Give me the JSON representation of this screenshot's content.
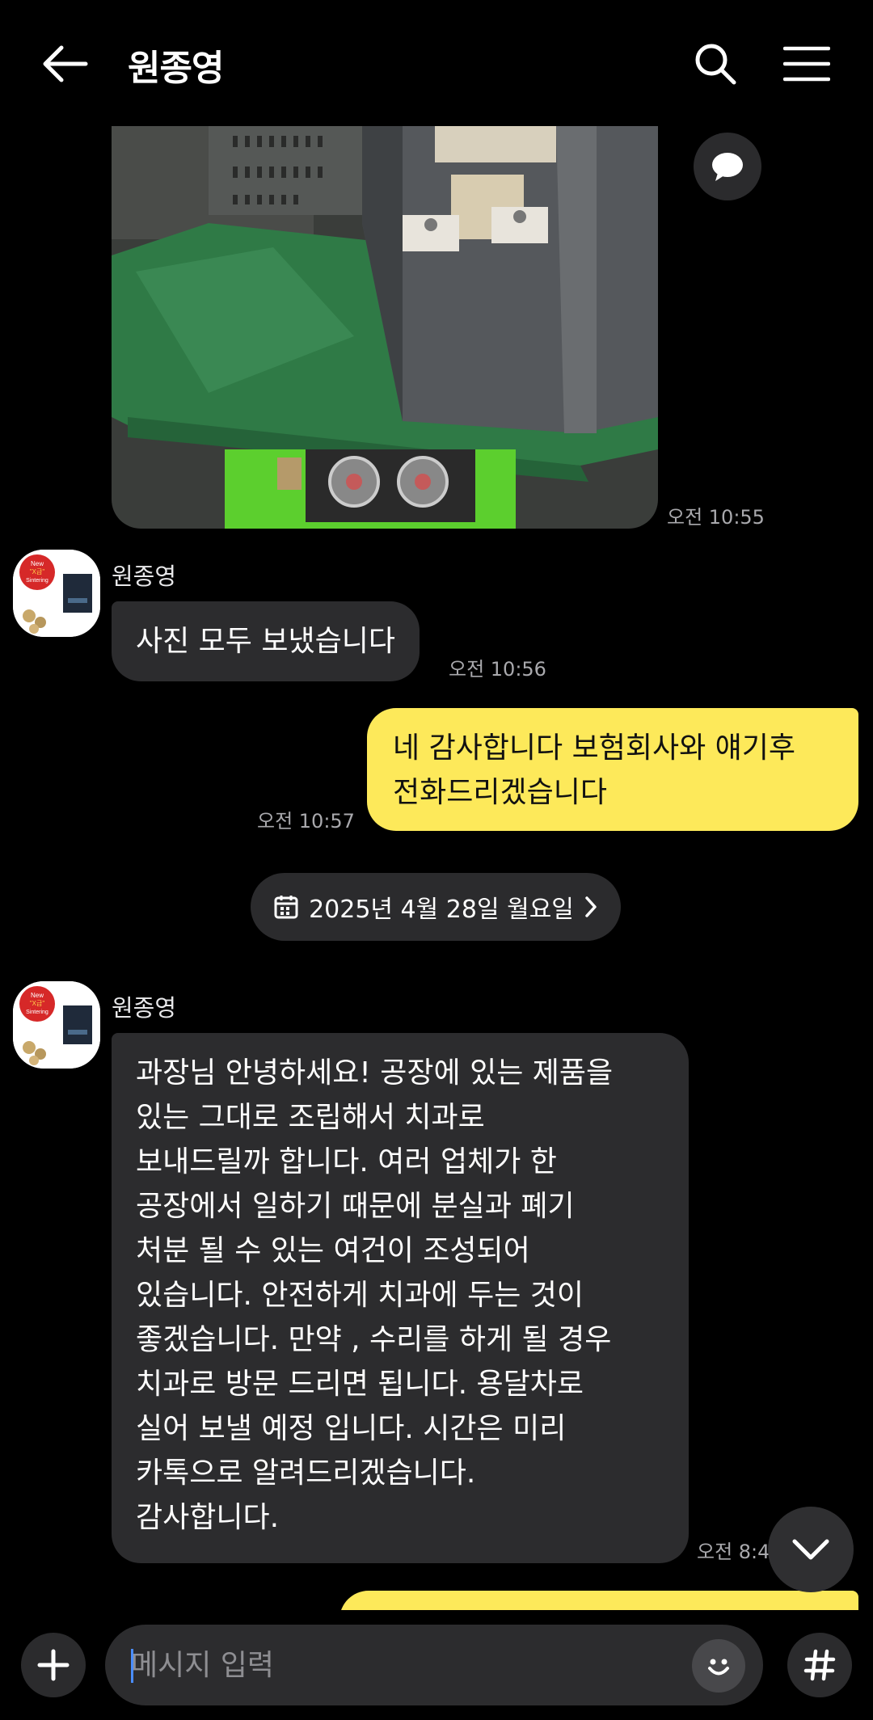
{
  "header": {
    "title": "원종영",
    "back_icon": "arrow-left-icon",
    "search_icon": "search-icon",
    "menu_icon": "hamburger-menu-icon"
  },
  "messages": {
    "photo_time": "오전 10:55",
    "msg1": {
      "sender": "원종영",
      "text": "사진 모두 보냈습니다",
      "time": "오전 10:56"
    },
    "msg2": {
      "lines": [
        "네 감사합니다 보험회사와 얘기후",
        "전화드리겠습니다"
      ],
      "time": "오전 10:57"
    },
    "date_divider": "2025년 4월 28일 월요일",
    "msg3": {
      "sender": "원종영",
      "lines": [
        "과장님 안녕하세요!  공장에 있는 제품을",
        "있는 그대로 조립해서 치과로",
        "보내드릴까 합니다. 여러 업체가 한",
        "공장에서 일하기 때문에 분실과 폐기",
        "처분 될 수 있는 여건이 조성되어",
        "있습니다. 안전하게 치과에 두는 것이",
        "좋겠습니다. 만약 , 수리를 하게 될 경우",
        "치과로 방문 드리면 됩니다. 용달차로",
        "실어 보낼 예정 입니다. 시간은 미리",
        "카톡으로 알려드리겠습니다.",
        "감사합니다."
      ],
      "time": "오전 8:45"
    }
  },
  "avatar": {
    "badge_line1": "New",
    "badge_line2": "\"X급\"",
    "badge_line3": "Sintering"
  },
  "input": {
    "placeholder": "메시지 입력",
    "plus_icon": "plus-icon",
    "emoji_icon": "emoji-icon",
    "hash_icon": "hash-icon"
  },
  "colors": {
    "background": "#000000",
    "incoming_bubble": "#2c2c2e",
    "outgoing_bubble": "#fde95a",
    "time_text": "#a9a9ad"
  }
}
